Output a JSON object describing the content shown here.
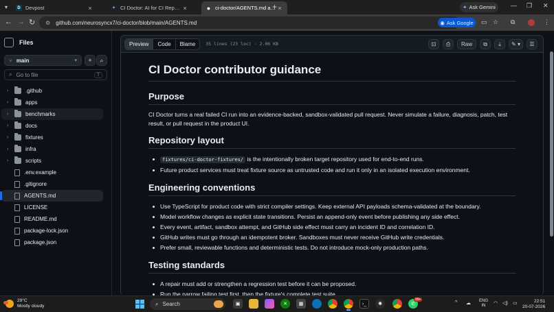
{
  "browser": {
    "tabs": [
      {
        "title": "Devpost",
        "favicon": "D",
        "favcolor": "#003e54",
        "active": false
      },
      {
        "title": "CI Doctor: AI for CI Repairs - Gi",
        "favicon": "✦",
        "favcolor": "#1f6feb",
        "active": false
      },
      {
        "title": "ci-doctor/AGENTS.md at main",
        "favicon": "●",
        "favcolor": "#ffffff",
        "active": true
      }
    ],
    "ask_gemini": "Ask Gemini",
    "url": "github.com/neurosyncx7/ci-doctor/blob/main/AGENTS.md",
    "ask_google": "Ask Google"
  },
  "sidebar": {
    "title": "Files",
    "branch": "main",
    "goto_placeholder": "Go to file",
    "goto_shortcut": "T",
    "items": [
      {
        "name": ".github",
        "type": "folder"
      },
      {
        "name": "apps",
        "type": "folder"
      },
      {
        "name": "benchmarks",
        "type": "folder"
      },
      {
        "name": "docs",
        "type": "folder"
      },
      {
        "name": "fixtures",
        "type": "folder"
      },
      {
        "name": "infra",
        "type": "folder"
      },
      {
        "name": "scripts",
        "type": "folder"
      },
      {
        "name": ".env.example",
        "type": "file"
      },
      {
        "name": ".gitignore",
        "type": "file"
      },
      {
        "name": "AGENTS.md",
        "type": "file"
      },
      {
        "name": "LICENSE",
        "type": "file"
      },
      {
        "name": "README.md",
        "type": "file"
      },
      {
        "name": "package-lock.json",
        "type": "file"
      },
      {
        "name": "package.json",
        "type": "file"
      }
    ],
    "selected": "AGENTS.md",
    "hovered": "benchmarks"
  },
  "file_header": {
    "view_tabs": [
      "Preview",
      "Code",
      "Blame"
    ],
    "active_view": "Preview",
    "meta": "35 lines (23 loc) · 2.06 KB",
    "raw_label": "Raw"
  },
  "doc": {
    "title": "CI Doctor contributor guidance",
    "purpose_heading": "Purpose",
    "purpose_text": "CI Doctor turns a real failed CI run into an evidence-backed, sandbox-validated pull request. Never simulate a failure, diagnosis, patch, test result, or pull request in the product UI.",
    "layout_heading": "Repository layout",
    "layout_code": "fixtures/ci-doctor-fixtures/",
    "layout_item1_rest": " is the intentionally broken target repository used for end-to-end runs.",
    "layout_item2": "Future product services must treat fixture source as untrusted code and run it only in an isolated execution environment.",
    "eng_heading": "Engineering conventions",
    "eng_items": [
      "Use TypeScript for product code with strict compiler settings. Keep external API payloads schema-validated at the boundary.",
      "Model workflow changes as explicit state transitions. Persist an append-only event before publishing any side effect.",
      "Every event, artifact, sandbox attempt, and GitHub side effect must carry an incident ID and correlation ID.",
      "GitHub writes must go through an idempotent broker. Sandboxes must never receive GitHub write credentials.",
      "Prefer small, reviewable functions and deterministic tests. Do not introduce mock-only production paths."
    ],
    "test_heading": "Testing standards",
    "test_items": [
      "A repair must add or strengthen a regression test before it can be proposed.",
      "Run the narrow failing test first, then the fixture's complete test suite."
    ]
  },
  "taskbar": {
    "temp": "29°C",
    "weather": "Mostly cloudy",
    "search": "Search",
    "lang1": "ENG",
    "lang2": "IN",
    "time": "22:51",
    "date": "20-07-2026",
    "badge": "99+"
  }
}
